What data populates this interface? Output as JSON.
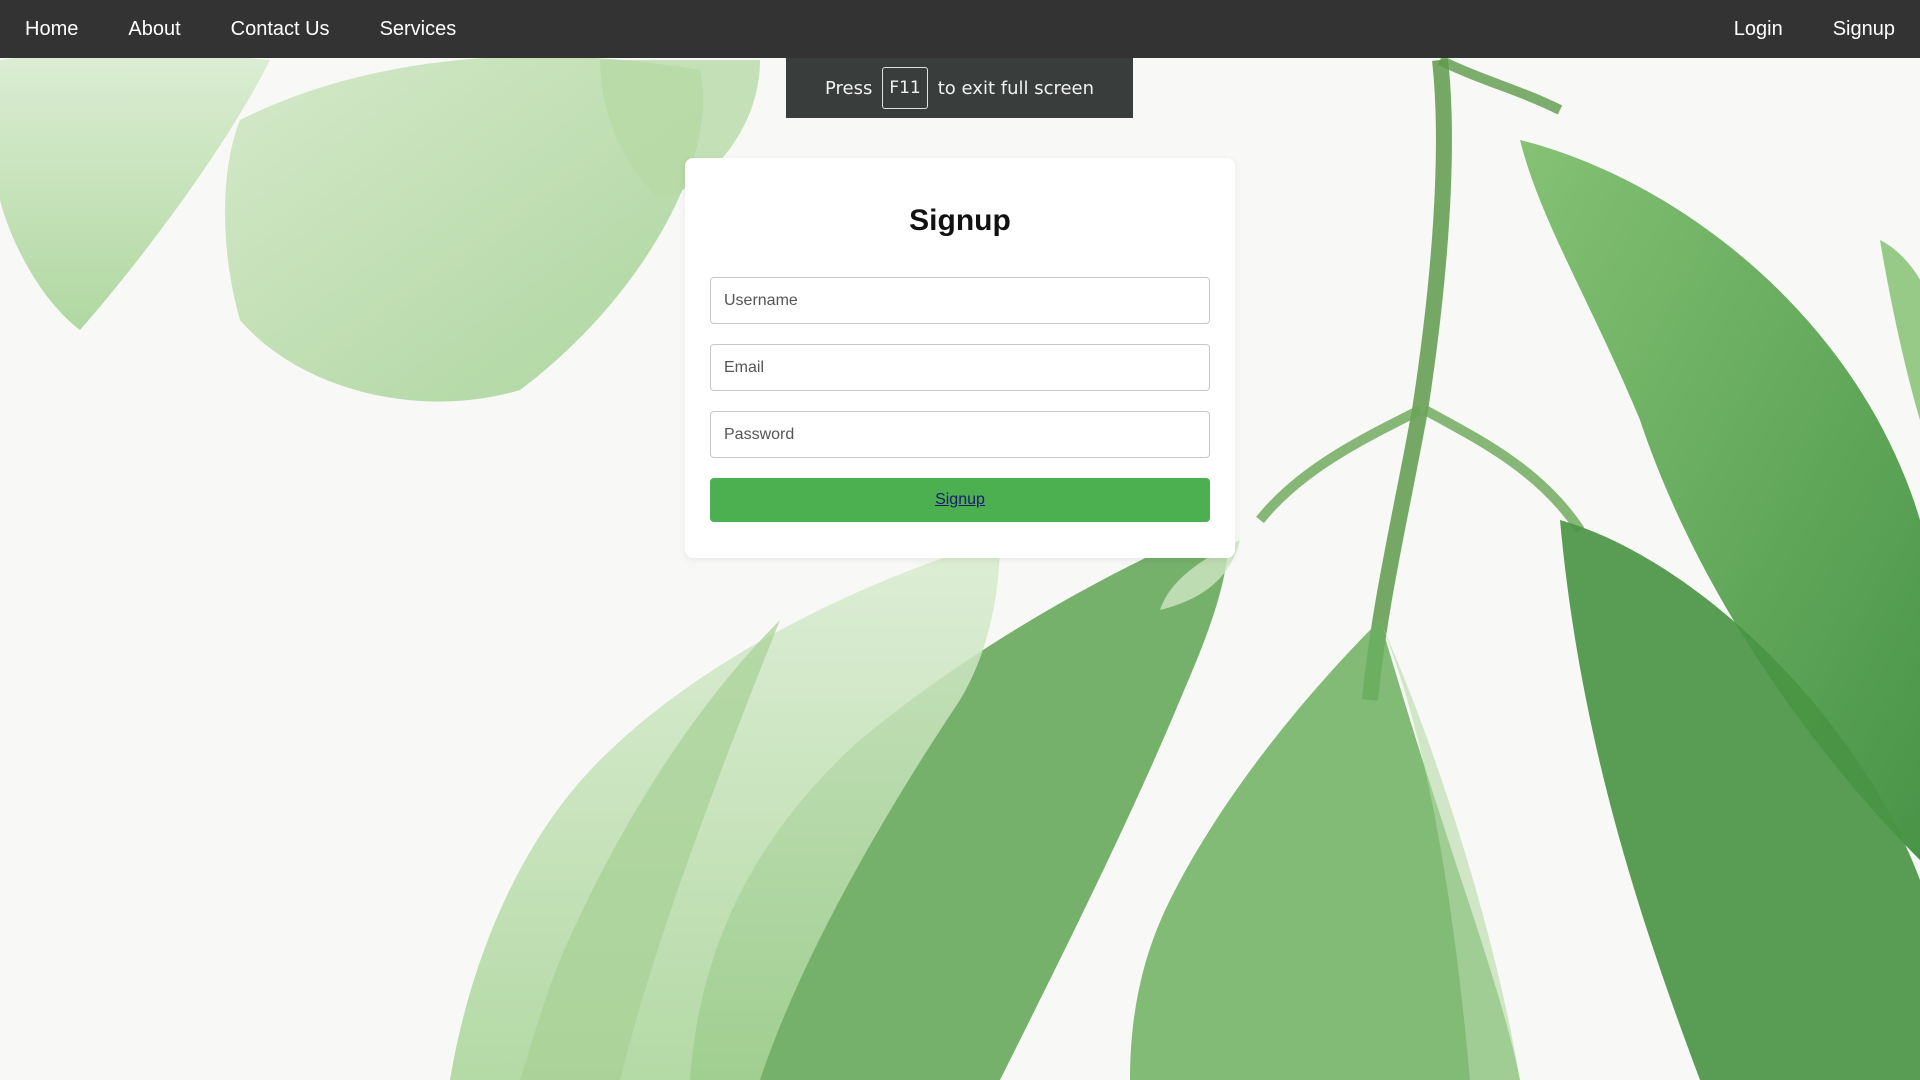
{
  "nav": {
    "left": [
      {
        "label": "Home"
      },
      {
        "label": "About"
      },
      {
        "label": "Contact Us"
      },
      {
        "label": "Services"
      }
    ],
    "right": [
      {
        "label": "Login"
      },
      {
        "label": "Signup"
      }
    ]
  },
  "fullscreen_notice": {
    "prefix": "Press",
    "key": "F11",
    "suffix": "to exit full screen"
  },
  "signup_form": {
    "title": "Signup",
    "username_placeholder": "Username",
    "email_placeholder": "Email",
    "password_placeholder": "Password",
    "submit_label": "Signup"
  },
  "colors": {
    "navbar": "#333333",
    "button": "#4caf50",
    "card": "#ffffff",
    "leaf_dark": "#4f9a48",
    "leaf_light": "#b9dca9"
  }
}
